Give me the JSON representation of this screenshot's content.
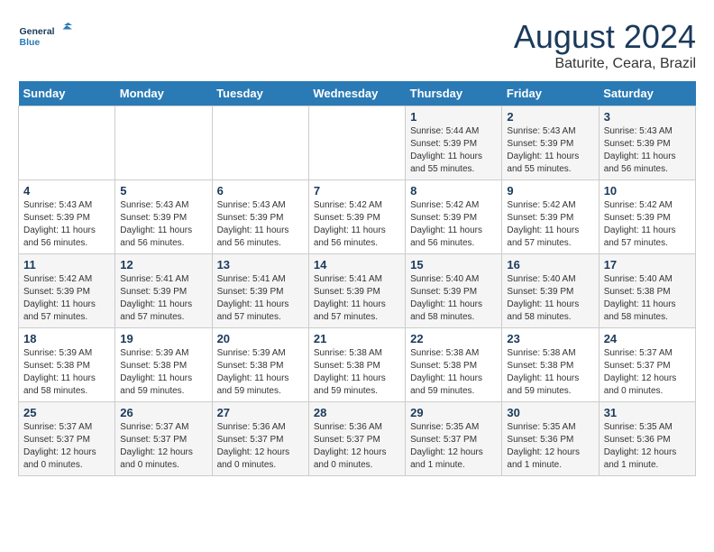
{
  "header": {
    "logo_line1": "General",
    "logo_line2": "Blue",
    "month_title": "August 2024",
    "location": "Baturite, Ceara, Brazil"
  },
  "weekdays": [
    "Sunday",
    "Monday",
    "Tuesday",
    "Wednesday",
    "Thursday",
    "Friday",
    "Saturday"
  ],
  "weeks": [
    [
      {
        "day": "",
        "info": ""
      },
      {
        "day": "",
        "info": ""
      },
      {
        "day": "",
        "info": ""
      },
      {
        "day": "",
        "info": ""
      },
      {
        "day": "1",
        "info": "Sunrise: 5:44 AM\nSunset: 5:39 PM\nDaylight: 11 hours and 55 minutes."
      },
      {
        "day": "2",
        "info": "Sunrise: 5:43 AM\nSunset: 5:39 PM\nDaylight: 11 hours and 55 minutes."
      },
      {
        "day": "3",
        "info": "Sunrise: 5:43 AM\nSunset: 5:39 PM\nDaylight: 11 hours and 56 minutes."
      }
    ],
    [
      {
        "day": "4",
        "info": "Sunrise: 5:43 AM\nSunset: 5:39 PM\nDaylight: 11 hours and 56 minutes."
      },
      {
        "day": "5",
        "info": "Sunrise: 5:43 AM\nSunset: 5:39 PM\nDaylight: 11 hours and 56 minutes."
      },
      {
        "day": "6",
        "info": "Sunrise: 5:43 AM\nSunset: 5:39 PM\nDaylight: 11 hours and 56 minutes."
      },
      {
        "day": "7",
        "info": "Sunrise: 5:42 AM\nSunset: 5:39 PM\nDaylight: 11 hours and 56 minutes."
      },
      {
        "day": "8",
        "info": "Sunrise: 5:42 AM\nSunset: 5:39 PM\nDaylight: 11 hours and 56 minutes."
      },
      {
        "day": "9",
        "info": "Sunrise: 5:42 AM\nSunset: 5:39 PM\nDaylight: 11 hours and 57 minutes."
      },
      {
        "day": "10",
        "info": "Sunrise: 5:42 AM\nSunset: 5:39 PM\nDaylight: 11 hours and 57 minutes."
      }
    ],
    [
      {
        "day": "11",
        "info": "Sunrise: 5:42 AM\nSunset: 5:39 PM\nDaylight: 11 hours and 57 minutes."
      },
      {
        "day": "12",
        "info": "Sunrise: 5:41 AM\nSunset: 5:39 PM\nDaylight: 11 hours and 57 minutes."
      },
      {
        "day": "13",
        "info": "Sunrise: 5:41 AM\nSunset: 5:39 PM\nDaylight: 11 hours and 57 minutes."
      },
      {
        "day": "14",
        "info": "Sunrise: 5:41 AM\nSunset: 5:39 PM\nDaylight: 11 hours and 57 minutes."
      },
      {
        "day": "15",
        "info": "Sunrise: 5:40 AM\nSunset: 5:39 PM\nDaylight: 11 hours and 58 minutes."
      },
      {
        "day": "16",
        "info": "Sunrise: 5:40 AM\nSunset: 5:39 PM\nDaylight: 11 hours and 58 minutes."
      },
      {
        "day": "17",
        "info": "Sunrise: 5:40 AM\nSunset: 5:38 PM\nDaylight: 11 hours and 58 minutes."
      }
    ],
    [
      {
        "day": "18",
        "info": "Sunrise: 5:39 AM\nSunset: 5:38 PM\nDaylight: 11 hours and 58 minutes."
      },
      {
        "day": "19",
        "info": "Sunrise: 5:39 AM\nSunset: 5:38 PM\nDaylight: 11 hours and 59 minutes."
      },
      {
        "day": "20",
        "info": "Sunrise: 5:39 AM\nSunset: 5:38 PM\nDaylight: 11 hours and 59 minutes."
      },
      {
        "day": "21",
        "info": "Sunrise: 5:38 AM\nSunset: 5:38 PM\nDaylight: 11 hours and 59 minutes."
      },
      {
        "day": "22",
        "info": "Sunrise: 5:38 AM\nSunset: 5:38 PM\nDaylight: 11 hours and 59 minutes."
      },
      {
        "day": "23",
        "info": "Sunrise: 5:38 AM\nSunset: 5:38 PM\nDaylight: 11 hours and 59 minutes."
      },
      {
        "day": "24",
        "info": "Sunrise: 5:37 AM\nSunset: 5:37 PM\nDaylight: 12 hours and 0 minutes."
      }
    ],
    [
      {
        "day": "25",
        "info": "Sunrise: 5:37 AM\nSunset: 5:37 PM\nDaylight: 12 hours and 0 minutes."
      },
      {
        "day": "26",
        "info": "Sunrise: 5:37 AM\nSunset: 5:37 PM\nDaylight: 12 hours and 0 minutes."
      },
      {
        "day": "27",
        "info": "Sunrise: 5:36 AM\nSunset: 5:37 PM\nDaylight: 12 hours and 0 minutes."
      },
      {
        "day": "28",
        "info": "Sunrise: 5:36 AM\nSunset: 5:37 PM\nDaylight: 12 hours and 0 minutes."
      },
      {
        "day": "29",
        "info": "Sunrise: 5:35 AM\nSunset: 5:37 PM\nDaylight: 12 hours and 1 minute."
      },
      {
        "day": "30",
        "info": "Sunrise: 5:35 AM\nSunset: 5:36 PM\nDaylight: 12 hours and 1 minute."
      },
      {
        "day": "31",
        "info": "Sunrise: 5:35 AM\nSunset: 5:36 PM\nDaylight: 12 hours and 1 minute."
      }
    ]
  ]
}
